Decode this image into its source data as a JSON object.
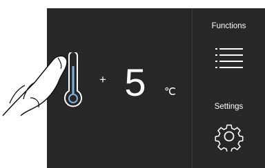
{
  "temperature": {
    "sign": "+",
    "value": "5",
    "unit": "℃"
  },
  "functions": {
    "label": "Functions",
    "icon": "menu-list-icon"
  },
  "settings": {
    "label": "Settings",
    "icon": "gear-icon"
  },
  "colors": {
    "panel_background": "#272727",
    "text": "#ffffff",
    "thermometer_accent": "#7fb2e0"
  }
}
